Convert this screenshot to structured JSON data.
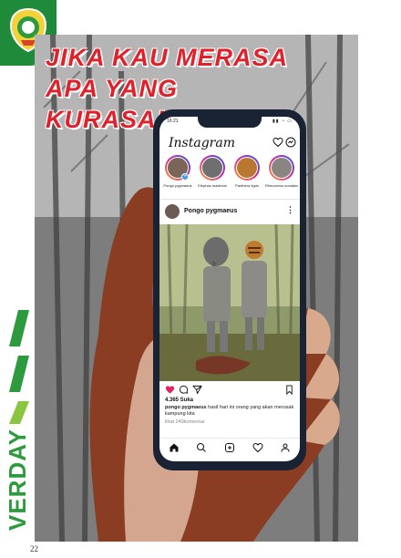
{
  "headline": {
    "line1": "JIKA KAU MERASA",
    "line2": "APA YANG KURASA!!!"
  },
  "phone": {
    "status_time": "16:21",
    "status_icons": "▮▮ ◔ ▭",
    "app_name": "Instagram",
    "stories": [
      {
        "label": "Pongo pygmaeus",
        "color": "#7a6558",
        "add": true
      },
      {
        "label": "Elephas maximus",
        "color": "#6f6f6f",
        "add": false
      },
      {
        "label": "Panthera tigris",
        "color": "#b9772f",
        "add": false
      },
      {
        "label": "Rhinoceros sondaicus",
        "color": "#8a8580",
        "add": false
      }
    ],
    "post": {
      "username": "Pongo pygmaeus",
      "likes": "4.365 Suka",
      "caption_user": "pongo pygmaeus",
      "caption_text": "hasil hari ini orang yang akan merusak kampung kita",
      "comments": "lihat 249komentar"
    },
    "icons": {
      "heart": "heart-icon",
      "dm": "direct-message-icon",
      "like": "like-filled-icon",
      "comment": "comment-icon",
      "share": "share-icon",
      "save": "bookmark-icon",
      "home": "home-icon",
      "search": "search-icon",
      "add": "add-post-icon",
      "activity": "activity-icon",
      "profile": "profile-icon"
    }
  },
  "side_label": "VERDAY",
  "page_number": "22",
  "colors": {
    "brand_green": "#2e9a3e",
    "headline_red": "#e0202a",
    "like_red": "#e0245e"
  }
}
